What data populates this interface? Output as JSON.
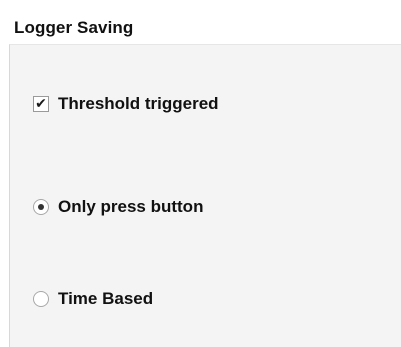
{
  "panel": {
    "title": "Logger Saving"
  },
  "options": {
    "threshold": {
      "label": "Threshold triggered",
      "checked": true,
      "check_glyph": "✔"
    },
    "only_press": {
      "label": "Only press button",
      "selected": true
    },
    "time_based": {
      "label": "Time Based",
      "selected": false
    }
  },
  "colors": {
    "group_background": "#f4f4f4",
    "text": "#111111"
  }
}
